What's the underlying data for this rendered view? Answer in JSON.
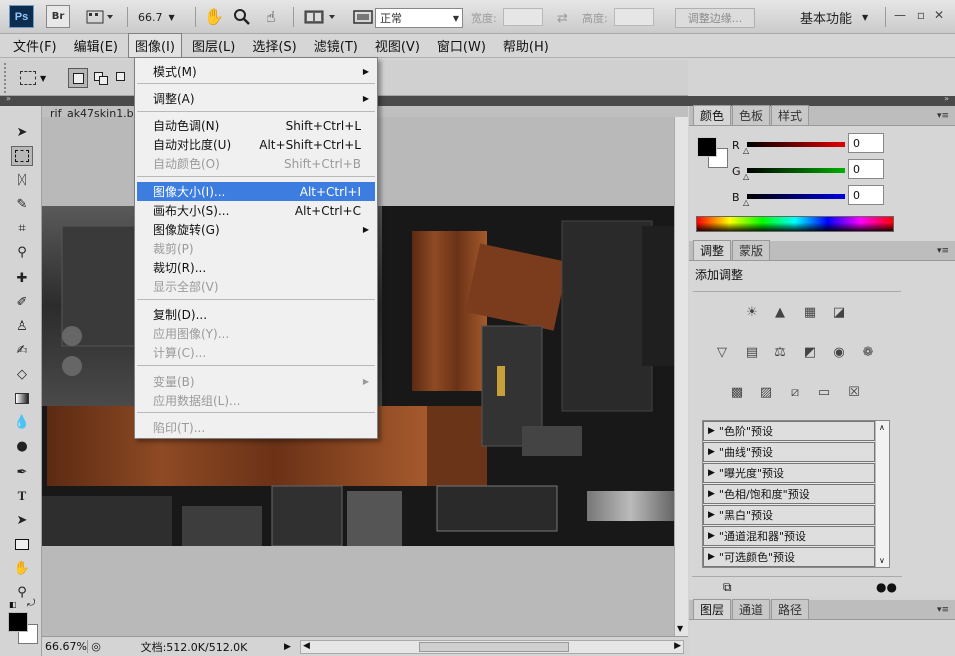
{
  "titlebar": {
    "ps_logo": "Ps",
    "br_logo": "Br",
    "zoom": "66.7",
    "workspace": "基本功能",
    "icons": [
      "frame-icon",
      "hand-icon",
      "zoom-icon",
      "rotate-view-icon",
      "arrange-documents-icon",
      "screen-mode-icon"
    ]
  },
  "menubar": [
    {
      "label": "文件(F)"
    },
    {
      "label": "编辑(E)"
    },
    {
      "label": "图像(I)"
    },
    {
      "label": "图层(L)"
    },
    {
      "label": "选择(S)"
    },
    {
      "label": "滤镜(T)"
    },
    {
      "label": "视图(V)"
    },
    {
      "label": "窗口(W)"
    },
    {
      "label": "帮助(H)"
    }
  ],
  "options": {
    "style_value": "正常",
    "width_label": "宽度:",
    "height_label": "高度:",
    "refine_edge": "调整边缘..."
  },
  "document": {
    "tab": "rif_ak47skin1.b",
    "zoom_status": "66.67%",
    "doc_info": "文档:512.0K/512.0K"
  },
  "image_menu": {
    "items": [
      {
        "label": "模式(M)",
        "shortcut": "",
        "submenu": true,
        "disabled": false
      },
      {
        "sep": true
      },
      {
        "label": "调整(A)",
        "shortcut": "",
        "submenu": true,
        "disabled": false
      },
      {
        "sep": true
      },
      {
        "label": "自动色调(N)",
        "shortcut": "Shift+Ctrl+L",
        "submenu": false,
        "disabled": false
      },
      {
        "label": "自动对比度(U)",
        "shortcut": "Alt+Shift+Ctrl+L",
        "submenu": false,
        "disabled": false
      },
      {
        "label": "自动颜色(O)",
        "shortcut": "Shift+Ctrl+B",
        "submenu": false,
        "disabled": true
      },
      {
        "sep": true
      },
      {
        "label": "图像大小(I)...",
        "shortcut": "Alt+Ctrl+I",
        "submenu": false,
        "disabled": false,
        "highlighted": true
      },
      {
        "label": "画布大小(S)...",
        "shortcut": "Alt+Ctrl+C",
        "submenu": false,
        "disabled": false
      },
      {
        "label": "图像旋转(G)",
        "shortcut": "",
        "submenu": true,
        "disabled": false
      },
      {
        "label": "裁剪(P)",
        "shortcut": "",
        "submenu": false,
        "disabled": true
      },
      {
        "label": "裁切(R)...",
        "shortcut": "",
        "submenu": false,
        "disabled": false
      },
      {
        "label": "显示全部(V)",
        "shortcut": "",
        "submenu": false,
        "disabled": true
      },
      {
        "sep": true
      },
      {
        "label": "复制(D)...",
        "shortcut": "",
        "submenu": false,
        "disabled": false
      },
      {
        "label": "应用图像(Y)...",
        "shortcut": "",
        "submenu": false,
        "disabled": true
      },
      {
        "label": "计算(C)...",
        "shortcut": "",
        "submenu": false,
        "disabled": true
      },
      {
        "sep": true
      },
      {
        "label": "变量(B)",
        "shortcut": "",
        "submenu": true,
        "disabled": true
      },
      {
        "label": "应用数据组(L)...",
        "shortcut": "",
        "submenu": false,
        "disabled": true
      },
      {
        "sep": true
      },
      {
        "label": "陷印(T)...",
        "shortcut": "",
        "submenu": false,
        "disabled": true
      }
    ]
  },
  "color_panel": {
    "tabs": [
      "颜色",
      "色板",
      "样式"
    ],
    "channels": [
      {
        "label": "R",
        "value": "0",
        "color": "#e00000"
      },
      {
        "label": "G",
        "value": "0",
        "color": "#00b000"
      },
      {
        "label": "B",
        "value": "0",
        "color": "#0000e0"
      }
    ],
    "foreground": "#000000",
    "background": "#ffffff"
  },
  "adjustments_panel": {
    "tabs": [
      "调整",
      "蒙版"
    ],
    "title": "添加调整",
    "presets": [
      "\"色阶\"预设",
      "\"曲线\"预设",
      "\"曝光度\"预设",
      "\"色相/饱和度\"预设",
      "\"黑白\"预设",
      "\"通道混和器\"预设",
      "\"可选颜色\"预设"
    ]
  },
  "layers_panel": {
    "tabs": [
      "图层",
      "通道",
      "路径"
    ]
  }
}
